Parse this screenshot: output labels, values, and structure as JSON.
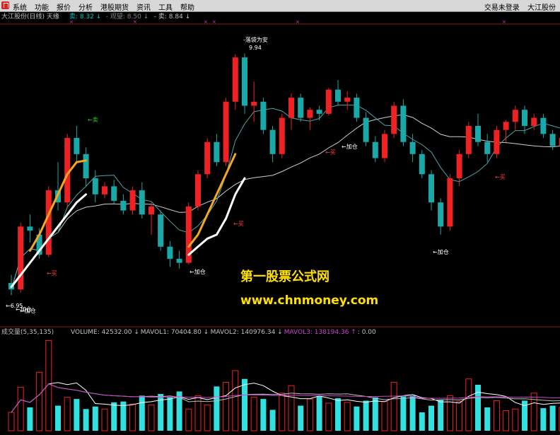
{
  "menu": [
    "系统",
    "功能",
    "报价",
    "分析",
    "港股期货",
    "资讯",
    "工具",
    "帮助"
  ],
  "status_right": {
    "login": "交易未登录",
    "stock": "大江股份"
  },
  "price_panel": {
    "title": "大江股份(日线) 天缘",
    "legend": [
      {
        "label": "卖: 8.32",
        "arrow": "↓",
        "color": "#00bfbf"
      },
      {
        "label": "- 观望: 8.50",
        "arrow": "↓",
        "color": "#808080"
      },
      {
        "label": "- 卖: 8.84",
        "arrow": "↓",
        "color": "#c0c0c0"
      }
    ],
    "annotations": [
      {
        "text": "←卖",
        "color": "#33cc33"
      },
      {
        "text": "-落袋为安",
        "color": "#ffffff"
      },
      {
        "text": "9.94",
        "color": "#ffffff"
      },
      {
        "text": "←加仓",
        "color": "#ffffff"
      },
      {
        "text": "←买",
        "color": "#ff4040"
      },
      {
        "text": "←买",
        "color": "#ff4040"
      },
      {
        "text": "←加仓",
        "color": "#ffffff"
      },
      {
        "text": "←买",
        "color": "#ff4040"
      },
      {
        "text": "←加仓",
        "color": "#ffffff"
      },
      {
        "text": "←买",
        "color": "#ff4040"
      },
      {
        "text": "←加仓",
        "color": "#ffffff"
      },
      {
        "text": "←6.95",
        "color": "#ffffff"
      },
      {
        "text": "←加仓",
        "color": "#ffffff"
      }
    ]
  },
  "volume_panel": {
    "title": "成交量(5,35,135)",
    "indicators": [
      {
        "label": "VOLUME: 42532.00",
        "arrow": "↓",
        "color": "#c0c0c0"
      },
      {
        "label": "MAVOL1: 70404.80",
        "arrow": "↓",
        "color": "#c0c0c0"
      },
      {
        "label": "MAVOL2: 140976.34",
        "arrow": "↓",
        "color": "#c0c0c0"
      },
      {
        "label": "MAVOL3: 138194.36",
        "arrow": "↑",
        "color": "#cc44cc"
      },
      {
        "label": ": 0.00",
        "arrow": "",
        "color": "#c0c0c0"
      }
    ]
  },
  "watermark": {
    "title": "第一股票公式网",
    "url": "www.chnmoney.com"
  },
  "colors": {
    "up": "#ee2222",
    "down": "#1aa8a8",
    "orange": "#f5a623",
    "white": "#ffffff",
    "vol_down": "#33e0e0",
    "ma_gray": "#cfcfcf",
    "ma_teal": "#4aa6a6"
  },
  "chart_data": {
    "type": "candlestick",
    "ohlc": [
      [
        7.1,
        7.2,
        6.95,
        7.02
      ],
      [
        7.02,
        7.85,
        6.98,
        7.8
      ],
      [
        7.8,
        7.95,
        7.6,
        7.75
      ],
      [
        7.7,
        7.78,
        7.4,
        7.45
      ],
      [
        7.45,
        8.3,
        7.42,
        8.25
      ],
      [
        8.25,
        8.6,
        8.0,
        8.1
      ],
      [
        8.1,
        8.95,
        8.05,
        8.9
      ],
      [
        8.9,
        9.05,
        8.6,
        8.7
      ],
      [
        8.7,
        8.78,
        8.3,
        8.4
      ],
      [
        8.4,
        8.5,
        8.1,
        8.2
      ],
      [
        8.2,
        8.35,
        8.15,
        8.3
      ],
      [
        8.3,
        8.38,
        8.08,
        8.12
      ],
      [
        8.12,
        8.2,
        7.95,
        8.0
      ],
      [
        8.0,
        8.3,
        7.95,
        8.25
      ],
      [
        8.25,
        8.35,
        7.9,
        7.95
      ],
      [
        7.95,
        8.1,
        7.7,
        8.05
      ],
      [
        7.95,
        8.0,
        7.5,
        7.55
      ],
      [
        7.55,
        7.62,
        7.3,
        7.4
      ],
      [
        7.4,
        7.5,
        7.28,
        7.35
      ],
      [
        7.35,
        8.1,
        7.33,
        8.05
      ],
      [
        8.05,
        8.5,
        8.0,
        8.45
      ],
      [
        8.45,
        8.9,
        8.4,
        8.85
      ],
      [
        8.85,
        8.95,
        8.55,
        8.6
      ],
      [
        8.6,
        9.4,
        8.55,
        9.35
      ],
      [
        9.35,
        9.94,
        9.25,
        9.9
      ],
      [
        9.9,
        9.95,
        9.2,
        9.3
      ],
      [
        9.3,
        9.6,
        9.1,
        9.35
      ],
      [
        9.35,
        9.4,
        8.95,
        9.0
      ],
      [
        9.0,
        9.05,
        8.6,
        8.7
      ],
      [
        8.7,
        9.2,
        8.65,
        9.15
      ],
      [
        9.15,
        9.45,
        9.0,
        9.4
      ],
      [
        9.4,
        9.45,
        9.1,
        9.15
      ],
      [
        9.15,
        9.28,
        9.0,
        9.25
      ],
      [
        9.25,
        9.3,
        9.12,
        9.2
      ],
      [
        9.2,
        9.52,
        9.18,
        9.5
      ],
      [
        9.5,
        9.62,
        9.3,
        9.35
      ],
      [
        9.35,
        9.48,
        9.25,
        9.4
      ],
      [
        9.4,
        9.45,
        9.1,
        9.15
      ],
      [
        9.15,
        9.22,
        8.8,
        8.85
      ],
      [
        8.85,
        8.92,
        8.6,
        8.65
      ],
      [
        8.65,
        9.0,
        8.6,
        8.95
      ],
      [
        8.95,
        9.35,
        8.9,
        9.3
      ],
      [
        9.3,
        9.38,
        8.8,
        8.85
      ],
      [
        8.85,
        8.95,
        8.6,
        8.7
      ],
      [
        8.7,
        8.75,
        8.4,
        8.45
      ],
      [
        8.45,
        8.5,
        8.0,
        8.1
      ],
      [
        8.1,
        8.15,
        7.7,
        7.8
      ],
      [
        7.8,
        8.45,
        7.75,
        8.4
      ],
      [
        8.4,
        8.75,
        8.3,
        8.7
      ],
      [
        8.7,
        9.1,
        8.65,
        9.05
      ],
      [
        9.05,
        9.2,
        8.8,
        8.85
      ],
      [
        8.85,
        8.95,
        8.6,
        8.7
      ],
      [
        8.7,
        9.05,
        8.65,
        9.0
      ],
      [
        9.0,
        9.12,
        8.85,
        9.1
      ],
      [
        9.1,
        9.3,
        9.0,
        9.25
      ],
      [
        9.25,
        9.3,
        8.95,
        9.05
      ],
      [
        9.05,
        9.2,
        9.0,
        9.15
      ],
      [
        9.15,
        9.2,
        8.9,
        8.95
      ],
      [
        8.95,
        9.0,
        8.75,
        8.8
      ],
      [
        8.8,
        8.95,
        8.65,
        8.9
      ]
    ],
    "signal_orange": [
      null,
      null,
      7.5,
      7.7,
      7.95,
      8.2,
      8.45,
      8.6,
      8.62,
      null,
      null,
      null,
      null,
      null,
      null,
      null,
      null,
      null,
      null,
      7.55,
      7.7,
      7.95,
      8.2,
      8.45,
      8.7,
      null,
      null,
      null,
      null,
      null,
      null,
      null,
      null,
      null,
      null,
      null,
      null,
      null,
      null,
      null,
      null,
      null,
      null,
      null,
      null,
      null,
      null,
      null,
      null,
      null,
      null,
      null,
      null,
      null,
      null,
      null,
      null,
      null,
      null,
      null
    ],
    "signal_white": [
      7.05,
      7.2,
      7.35,
      7.5,
      7.65,
      7.8,
      7.95,
      8.1,
      8.2,
      null,
      null,
      null,
      null,
      null,
      null,
      null,
      null,
      null,
      null,
      7.45,
      7.55,
      7.65,
      7.7,
      7.9,
      8.2,
      8.4,
      null,
      null,
      null,
      null,
      null,
      null,
      null,
      null,
      null,
      null,
      null,
      null,
      null,
      null,
      null,
      null,
      null,
      null,
      null,
      null,
      null,
      null,
      null,
      null,
      null,
      null,
      null,
      null,
      null,
      null,
      null,
      null,
      null,
      null
    ],
    "volume": [
      22000,
      52000,
      28000,
      70000,
      108000,
      30000,
      40000,
      38000,
      26000,
      29000,
      26000,
      34000,
      35000,
      32000,
      42000,
      31000,
      44000,
      40000,
      47000,
      26000,
      42000,
      31000,
      53000,
      58000,
      72000,
      62000,
      40000,
      38000,
      25000,
      45000,
      54000,
      30000,
      38000,
      41000,
      33000,
      39000,
      34000,
      29000,
      36000,
      40000,
      35000,
      58000,
      41000,
      42000,
      22000,
      30000,
      37000,
      42000,
      35000,
      62000,
      55000,
      28000,
      36000,
      24000,
      26000,
      36000,
      45000,
      27000,
      30000,
      28000
    ],
    "volume_up": [
      true,
      true,
      false,
      true,
      true,
      false,
      true,
      false,
      false,
      false,
      true,
      false,
      false,
      true,
      false,
      true,
      false,
      false,
      false,
      true,
      true,
      true,
      false,
      true,
      true,
      false,
      true,
      false,
      false,
      true,
      true,
      false,
      true,
      false,
      true,
      false,
      true,
      false,
      false,
      false,
      true,
      true,
      false,
      false,
      false,
      false,
      false,
      true,
      true,
      true,
      false,
      false,
      true,
      true,
      true,
      false,
      true,
      false,
      false,
      true
    ]
  }
}
